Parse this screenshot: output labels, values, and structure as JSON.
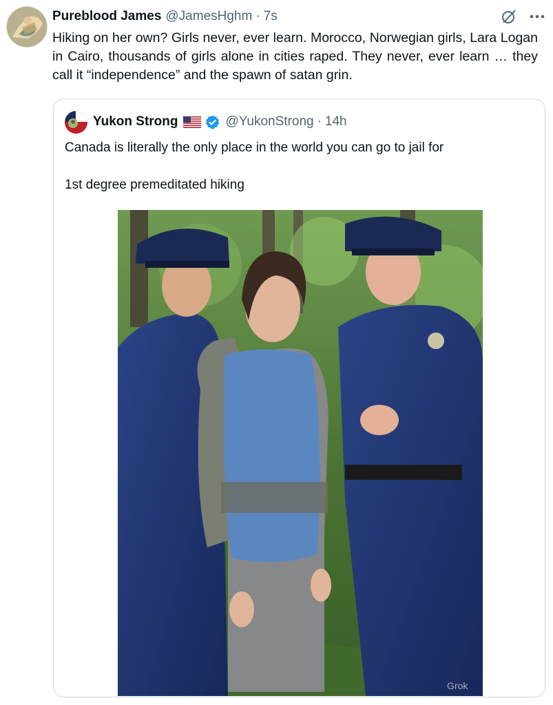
{
  "tweet": {
    "author": {
      "display_name": "Pureblood James",
      "handle": "@JamesHghm",
      "separator": "·",
      "time": "7s"
    },
    "text": "Hiking on her own?  Girls never, ever learn. Morocco, Norwegian girls, Lara Logan in Cairo, thousands of girls alone in cities raped. They never, ever learn … they call it “independence” and the spawn of satan grin.",
    "actions": {
      "grok_icon": "grok-icon",
      "more_icon": "more-icon"
    }
  },
  "quote": {
    "author": {
      "display_name": "Yukon Strong",
      "handle": "@YukonStrong",
      "separator": "·",
      "time": "14h",
      "flag_icon": "us-flag-icon",
      "verified_icon": "verified-badge-icon",
      "verified_color": "#1d9bf0"
    },
    "text": "Canada is literally the only place in the world you can go to jail for\n\n1st degree premeditated hiking",
    "media": {
      "image_icon": "photo-hiker-with-police",
      "watermark": "Grok"
    }
  },
  "colors": {
    "text_primary": "#0f1419",
    "text_secondary": "#536471",
    "border": "#cfd9de",
    "uniform": "#1f3470",
    "forest": "#4f7a3a"
  }
}
